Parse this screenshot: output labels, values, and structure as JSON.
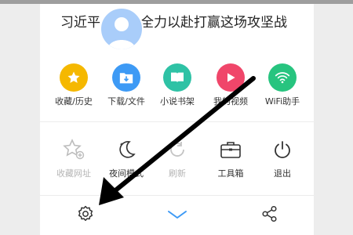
{
  "header": {
    "headline": "习近平：要求全力以赴打赢这场攻坚战"
  },
  "menu_row1": [
    {
      "label": "收藏/历史",
      "icon": "star-icon",
      "color": "#f5b800"
    },
    {
      "label": "下载/文件",
      "icon": "download-folder-icon",
      "color": "#3d9af5"
    },
    {
      "label": "小说书架",
      "icon": "book-icon",
      "color": "#2ec2a5"
    },
    {
      "label": "我的视频",
      "icon": "play-icon",
      "color": "#f0466a"
    },
    {
      "label": "WiFi助手",
      "icon": "wifi-icon",
      "color": "#27c47f"
    }
  ],
  "menu_row2": [
    {
      "label": "收藏网址",
      "icon": "star-add-icon",
      "enabled": false
    },
    {
      "label": "夜间模式",
      "icon": "moon-icon",
      "enabled": true
    },
    {
      "label": "刷新",
      "icon": "refresh-icon",
      "enabled": false
    },
    {
      "label": "工具箱",
      "icon": "toolbox-icon",
      "enabled": true
    },
    {
      "label": "退出",
      "icon": "power-icon",
      "enabled": true
    }
  ],
  "bottom_bar": {
    "icons": [
      "gear-icon",
      "chevron-down-icon",
      "share-icon"
    ],
    "accent": "#3d9af5"
  }
}
